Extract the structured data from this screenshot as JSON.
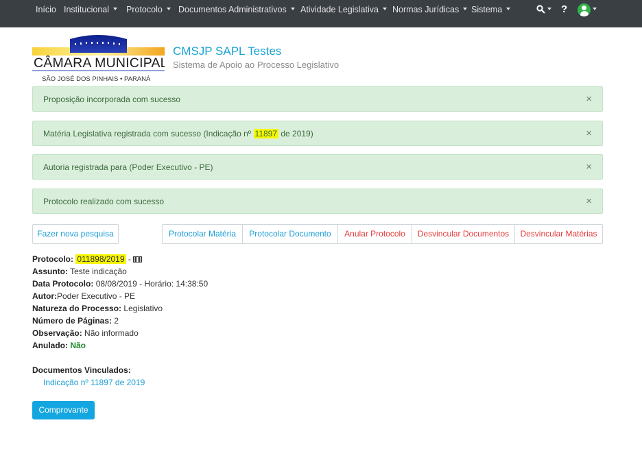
{
  "nav": {
    "items": [
      {
        "label": "Início",
        "dropdown": false
      },
      {
        "label": "Institucional",
        "dropdown": true
      },
      {
        "label": "Protocolo",
        "dropdown": true
      },
      {
        "label": "Documentos Administrativos",
        "dropdown": true
      },
      {
        "label": "Atividade Legislativa",
        "dropdown": true
      },
      {
        "label": "Normas Jurídicas",
        "dropdown": true
      },
      {
        "label": "Sistema",
        "dropdown": true
      }
    ],
    "search_icon": "search-icon",
    "help_label": "?",
    "user_icon": "user-icon"
  },
  "header": {
    "logo_icon": "camara-municipal-logo",
    "title": "CMSJP SAPL Testes",
    "subtitle": "Sistema de Apoio ao Processo Legislativo"
  },
  "alerts": [
    {
      "text": "Proposição incorporada com sucesso"
    },
    {
      "text_before": "Matéria Legislativa registrada com sucesso (Indicação nº ",
      "highlight": "11897",
      "text_after": " de 2019)"
    },
    {
      "text": "Autoria registrada para (Poder Executivo - PE)"
    },
    {
      "text": "Protocolo realizado com sucesso"
    }
  ],
  "close_symbol": "×",
  "actions": {
    "new_search": "Fazer nova pesquisa",
    "protocolar_materia": "Protocolar Matéria",
    "protocolar_documento": "Protocolar Documento",
    "anular_protocolo": "Anular Protocolo",
    "desvincular_documentos": "Desvincular Documentos",
    "desvincular_materias": "Desvincular Matérias"
  },
  "protocol": {
    "protocolo_label": "Protocolo:",
    "protocolo_value": "011898/2019",
    "protocolo_sep": "-",
    "assunto_label": "Assunto:",
    "assunto_value": "Teste indicação",
    "data_label": "Data Protocolo:",
    "data_value": "08/08/2019 - Horário: 14:38:50",
    "autor_label": "Autor:",
    "autor_value": "Poder Executivo - PE",
    "natureza_label": "Natureza do Processo:",
    "natureza_value": "Legislativo",
    "paginas_label": "Número de Páginas:",
    "paginas_value": "2",
    "observacao_label": "Observação:",
    "observacao_value": "Não informado",
    "anulado_label": "Anulado:",
    "anulado_value": "Não",
    "vinculados_label": "Documentos Vinculados:",
    "vinculado_doc": "Indicação nº 11897 de 2019"
  },
  "comprovante_label": "Comprovante",
  "colors": {
    "navbar_bg": "#3a3f44",
    "accent_blue": "#1aa3d6",
    "alert_bg": "#d9eedb",
    "danger_red": "#e33a3a",
    "success_green": "#1f8a2e",
    "highlight": "#f6f700"
  }
}
